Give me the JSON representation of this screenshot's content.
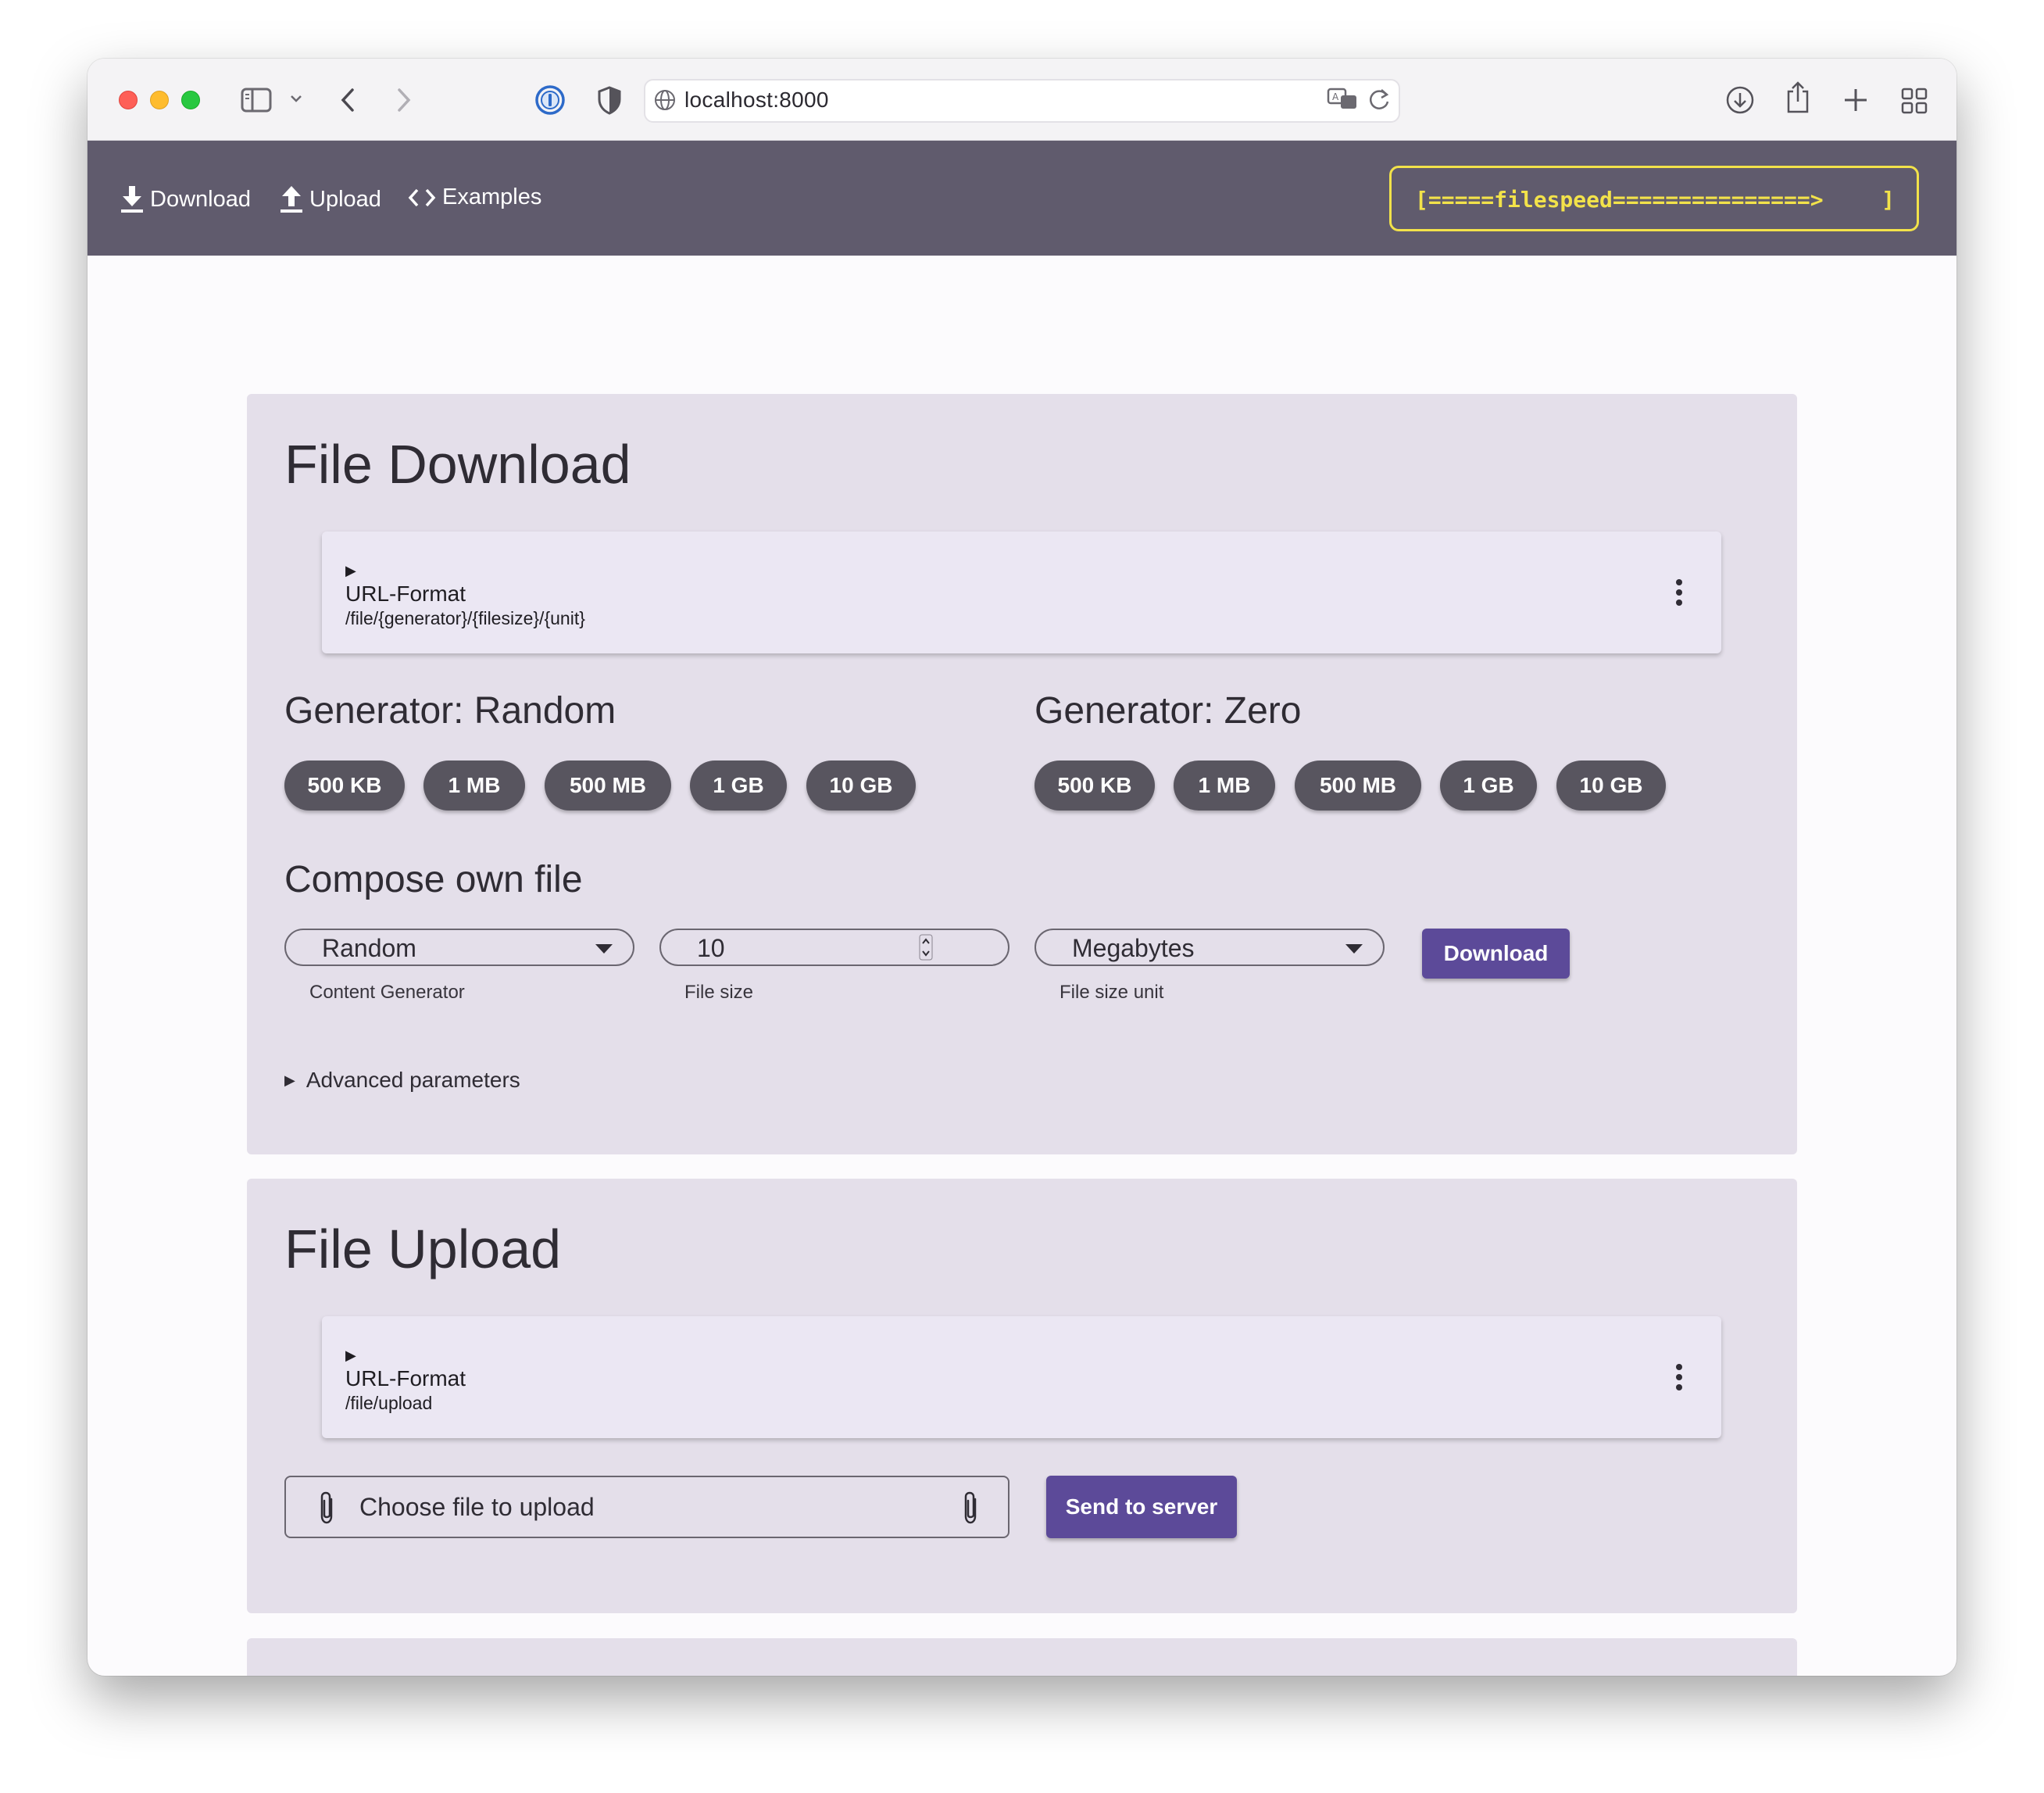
{
  "browser": {
    "url": "localhost:8000"
  },
  "nav": {
    "download_label": "Download",
    "upload_label": "Upload",
    "examples_label": "Examples",
    "speed_bar": "[=====filespeed===============>",
    "speed_end": "]"
  },
  "download_card": {
    "title": "File Download",
    "url_panel": {
      "marker": "▶",
      "title": "URL-Format",
      "path": "/file/{generator}/{filesize}/{unit}"
    },
    "random": {
      "heading": "Generator: Random",
      "chips": [
        "500 KB",
        "1 MB",
        "500 MB",
        "1 GB",
        "10 GB"
      ]
    },
    "zero": {
      "heading": "Generator: Zero",
      "chips": [
        "500 KB",
        "1 MB",
        "500 MB",
        "1 GB",
        "10 GB"
      ]
    },
    "compose": {
      "heading": "Compose own file",
      "generator_value": "Random",
      "generator_helper": "Content Generator",
      "size_value": "10",
      "size_helper": "File size",
      "unit_value": "Megabytes",
      "unit_helper": "File size unit",
      "button_label": "Download"
    },
    "advanced_label": "Advanced parameters"
  },
  "upload_card": {
    "title": "File Upload",
    "url_panel": {
      "marker": "▶",
      "title": "URL-Format",
      "path": "/file/upload"
    },
    "file_placeholder": "Choose file to upload",
    "button_label": "Send to server"
  },
  "colors": {
    "appbar": "#605b6d",
    "accent": "#5c4a99",
    "speed": "#f2e24a",
    "chip": "#58555f"
  },
  "icons": [
    "sidebar-icon",
    "chevron-down-icon",
    "back-icon",
    "forward-icon",
    "password-manager-icon",
    "shield-icon",
    "globe-icon",
    "translate-icon",
    "reload-icon",
    "downloads-icon",
    "share-icon",
    "new-tab-icon",
    "tab-overview-icon",
    "download-icon",
    "upload-icon",
    "code-icon",
    "more-vert-icon",
    "paperclip-icon"
  ]
}
